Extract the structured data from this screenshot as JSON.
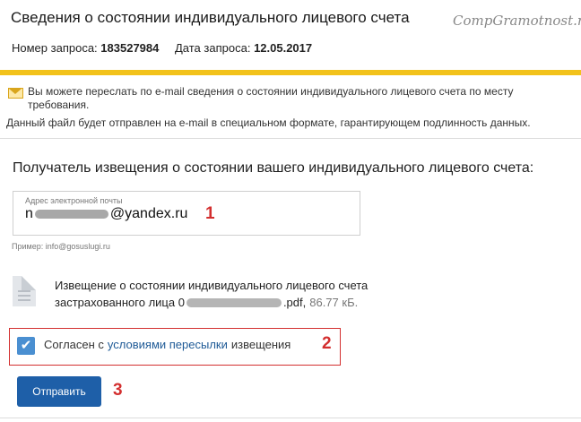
{
  "header": {
    "title": "Сведения о состоянии индивидуального лицевого счета",
    "watermark": "CompGramotnost.ru",
    "request_number_label": "Номер запроса:",
    "request_number": "183527984",
    "request_date_label": "Дата запроса:",
    "request_date": "12.05.2017"
  },
  "info": {
    "line1": "Вы можете переслать по e-mail сведения о состоянии индивидуального лицевого счета по месту требования.",
    "line2": "Данный файл будет отправлен на e-mail в специальном формате, гарантирующем подлинность данных."
  },
  "recipient": {
    "heading": "Получатель извещения о состоянии вашего индивидуального лицевого счета:",
    "email_label": "Адрес электронной почты",
    "email_prefix": "n",
    "email_suffix": "@yandex.ru",
    "example": "Пример: info@gosuslugi.ru"
  },
  "file": {
    "name_line1": "Извещение о состоянии индивидуального лицевого счета",
    "name_line2_prefix": "застрахованного лица 0",
    "name_line2_suffix": ".pdf,",
    "size": "86.77 кБ."
  },
  "consent": {
    "checked": true,
    "check_glyph": "✔",
    "text_before": "Согласен с",
    "link_text": "условиями пересылки",
    "text_after": "извещения"
  },
  "submit_label": "Отправить",
  "annotations": [
    "1",
    "2",
    "3"
  ],
  "colors": {
    "accent_yellow": "#f2c21b",
    "primary_blue": "#1e5fa8",
    "link_blue": "#1e5a96",
    "annotation_red": "#d32f2f"
  }
}
